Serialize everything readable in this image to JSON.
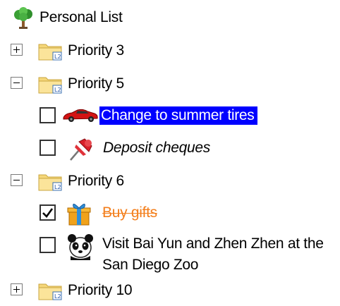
{
  "list": {
    "root_label": "Personal List",
    "root_icon": "tree-icon"
  },
  "groups": [
    {
      "label": "Priority 3",
      "expanded": false,
      "icon": "folder-icon"
    },
    {
      "label": "Priority 5",
      "expanded": true,
      "icon": "folder-icon"
    },
    {
      "label": "Priority 6",
      "expanded": true,
      "icon": "folder-icon"
    },
    {
      "label": "Priority 10",
      "expanded": false,
      "icon": "folder-icon"
    }
  ],
  "tasks": [
    {
      "label": "Change to summer tires",
      "checked": false,
      "icon": "car-icon",
      "state": "selected"
    },
    {
      "label": "Deposit cheques",
      "checked": false,
      "icon": "pushpin-icon",
      "state": "italic"
    },
    {
      "label": "Buy gifts",
      "checked": true,
      "icon": "gift-icon",
      "state": "completed"
    },
    {
      "label": "Visit Bai Yun and Zhen Zhen at the San Diego Zoo",
      "checked": false,
      "icon": "panda-icon",
      "state": "normal"
    }
  ],
  "colors": {
    "selection": "#0000ff",
    "completed": "#f37e1b"
  }
}
